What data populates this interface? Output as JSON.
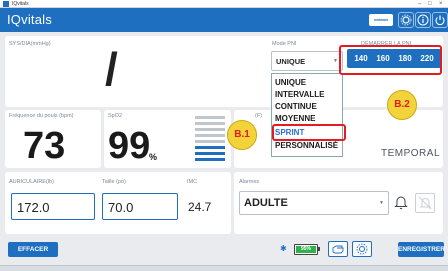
{
  "window": {
    "title": "IQvitals"
  },
  "app": {
    "brand": "IQvitals",
    "logo_text": "midmark",
    "colors": {
      "primary": "#1f6fc0",
      "annotation_red": "#e31b23",
      "annotation_yellow": "#f2d43a",
      "battery_green": "#2fb24a"
    }
  },
  "bp": {
    "label": "SYS/DIA(mmHg)",
    "value": "/"
  },
  "mode_pni": {
    "label": "Mode PNI",
    "selected": "UNIQUE",
    "options": [
      "UNIQUE",
      "INTERVALLE",
      "CONTINUE",
      "MOYENNE",
      "SPRINT",
      "PERSONNALISÉ"
    ],
    "highlighted": "SPRINT"
  },
  "pnl_start": {
    "label": "DÉMARRER LA PNI",
    "pressures": [
      "140",
      "160",
      "180",
      "220"
    ]
  },
  "pulse": {
    "label": "Fréquence du pouls (bpm)",
    "value": "73"
  },
  "spo2": {
    "label": "SpO2",
    "value": "99",
    "unit": "%"
  },
  "temperature": {
    "label_partial": "(F)",
    "mode": "TEMPORAL"
  },
  "annotations": {
    "b1": "B.1",
    "b2": "B.2"
  },
  "auricular": {
    "label": "AURICULAIRE(lb)",
    "value": "172.0"
  },
  "height": {
    "label": "Taille (po)",
    "value": "70.0"
  },
  "imc": {
    "label": "IMC",
    "value": "24.7"
  },
  "alarms": {
    "label": "Alarmes",
    "value": "ADULTE"
  },
  "footer": {
    "clear": "EFFACER",
    "save": "ENREGISTRER",
    "battery": "95%"
  }
}
